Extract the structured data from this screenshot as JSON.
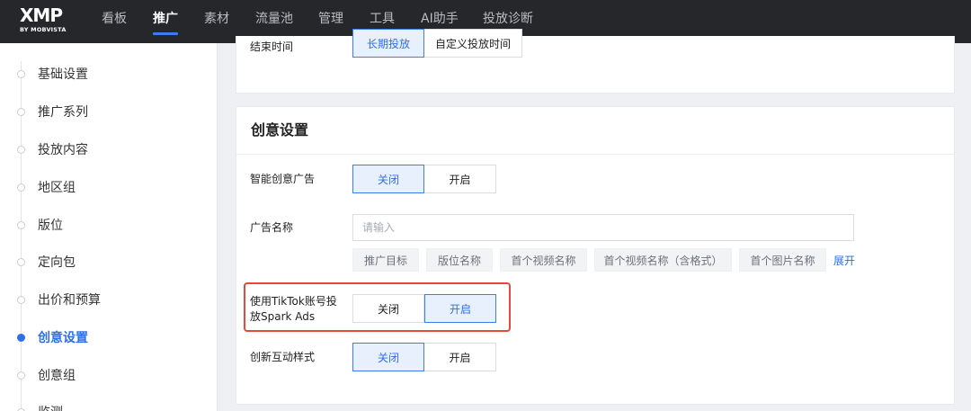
{
  "brand": {
    "logo_text": "XMP",
    "logo_sub": "BY MOBVISTA"
  },
  "nav": {
    "items": [
      {
        "label": "看板"
      },
      {
        "label": "推广"
      },
      {
        "label": "素材"
      },
      {
        "label": "流量池"
      },
      {
        "label": "管理"
      },
      {
        "label": "工具"
      },
      {
        "label": "AI助手"
      },
      {
        "label": "投放诊断"
      }
    ],
    "active": "推广"
  },
  "sidebar": {
    "items": [
      {
        "label": "基础设置"
      },
      {
        "label": "推广系列"
      },
      {
        "label": "投放内容"
      },
      {
        "label": "地区组"
      },
      {
        "label": "版位"
      },
      {
        "label": "定向包"
      },
      {
        "label": "出价和预算"
      },
      {
        "label": "创意设置"
      },
      {
        "label": "创意组"
      },
      {
        "label": "监测"
      }
    ],
    "active": "创意设置"
  },
  "schedule": {
    "label": "结束时间",
    "options": [
      "长期投放",
      "自定义投放时间"
    ],
    "selected": "长期投放"
  },
  "creative": {
    "title": "创意设置",
    "smart_creative": {
      "label": "智能创意广告",
      "off": "关闭",
      "on": "开启",
      "selected": "关闭"
    },
    "ad_name": {
      "label": "广告名称",
      "placeholder": "请输入",
      "tags": [
        "推广目标",
        "版位名称",
        "首个视频名称",
        "首个视频名称（含格式）",
        "首个图片名称"
      ],
      "expand": "展开"
    },
    "spark_ads": {
      "label_line1": "使用TikTok账号投",
      "label_line2": "放Spark Ads",
      "off": "关闭",
      "on": "开启",
      "selected": "开启"
    },
    "interactive": {
      "label": "创新互动样式",
      "off": "关闭",
      "on": "开启",
      "selected": "关闭"
    }
  },
  "colors": {
    "accent": "#2f6fe8",
    "highlight": "#e24a3b",
    "topbar": "#25272b"
  }
}
